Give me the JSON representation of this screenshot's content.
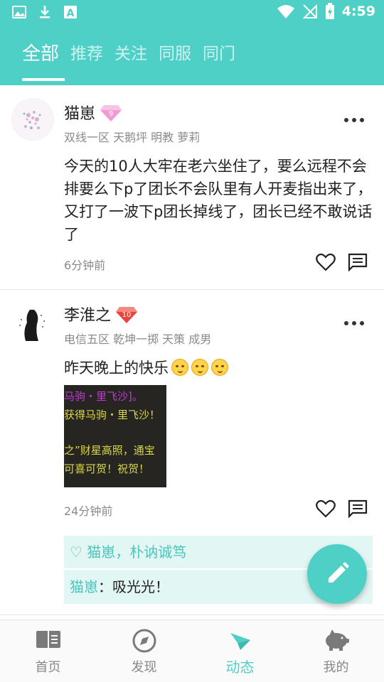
{
  "status_bar": {
    "time": "4:59",
    "left_icons": [
      "image-icon",
      "download-icon",
      "a-icon"
    ],
    "right_icons": [
      "wifi-icon",
      "no-signal-icon",
      "battery-charging-icon"
    ]
  },
  "tabs": [
    {
      "label": "全部",
      "active": true
    },
    {
      "label": "推荐",
      "active": false
    },
    {
      "label": "关注",
      "active": false
    },
    {
      "label": "同服",
      "active": false
    },
    {
      "label": "同门",
      "active": false
    }
  ],
  "posts": [
    {
      "name": "猫崽",
      "level": "9",
      "meta": "双线一区 天鹅坪 明教 萝莉",
      "content": "今天的10人大牢在老六坐住了，要么远程不会排要么下p了团长不会队里有人开麦指出来了，又打了一波下p团长掉线了，团长已经不敢说话了",
      "time": "6分钟前"
    },
    {
      "name": "李淮之",
      "level": "10",
      "meta": "电信五区 乾坤一掷 天策 成男",
      "content": "昨天晚上的快乐",
      "time": "24分钟前",
      "image_lines": [
        "马驹・里飞沙]。",
        "获得马驹・里飞沙！",
        "之”财星高照，通宝",
        "可喜可贺！祝贺！"
      ],
      "likes": "♡ 猫崽，朴讷诚笃",
      "comment": {
        "author": "猫崽",
        "separator": "：",
        "text": "吸光光！"
      }
    }
  ],
  "bottom_nav": [
    {
      "label": "首页",
      "icon": "book-icon",
      "active": false
    },
    {
      "label": "发现",
      "icon": "compass-icon",
      "active": false
    },
    {
      "label": "动态",
      "icon": "paper-plane-icon",
      "active": true
    },
    {
      "label": "我的",
      "icon": "piggy-icon",
      "active": false
    }
  ],
  "colors": {
    "accent": "#4fd0c7",
    "comment_bg": "#e2f6f4",
    "meta_text": "#8a8a8a"
  }
}
